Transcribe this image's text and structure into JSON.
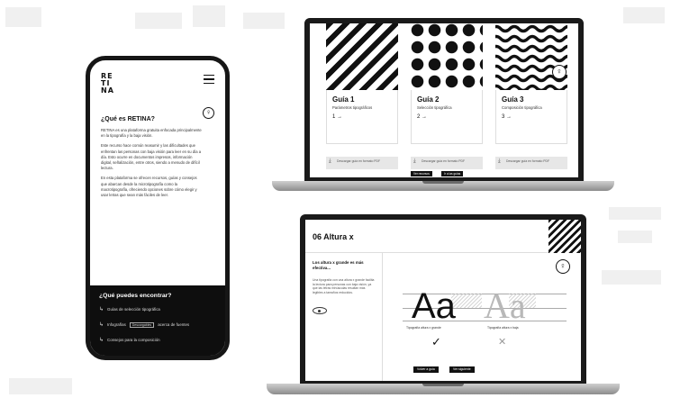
{
  "phone": {
    "logo_lines": [
      "RE",
      "TI",
      "NA"
    ],
    "title": "¿Qué es RETINA?",
    "paragraphs": [
      "RETINA es una plataforma gratuita enfocada principalmente en la tipografía y la baja visión.",
      "Este recurso hace común reasumir y las dificultades que enfrentan las personas con baja visión para leer en su día a día. Esto ocurre en documentos impresos, información digital, señalización, entre otros, siendo a menudo de difícil lectura.",
      "En esta plataforma se ofrecen recursos, guías y consejos que abarcan desde la microtipografía como la macrotipografía, ofreciendo opciones sobre cómo elegir y usar letras que sean más fáciles de leer."
    ],
    "section_title": "¿Qué puedes encontrar?",
    "list": [
      {
        "label": "Guías de selección tipográfica"
      },
      {
        "label": "Infografías",
        "pill": "Descargables",
        "suffix": "acerca de fuentes"
      },
      {
        "label": "Consejos para la composición"
      }
    ]
  },
  "laptop1": {
    "guides": [
      {
        "title": "Guía 1",
        "subtitle": "Parámetros tipográficos",
        "arrow": "1 →",
        "download": "Descargar guía en formato PDF"
      },
      {
        "title": "Guía 2",
        "subtitle": "Selección tipográfica",
        "arrow": "2 →",
        "download": "Descargar guía en formato PDF"
      },
      {
        "title": "Guía 3",
        "subtitle": "Composición tipográfica",
        "arrow": "3 →",
        "download": "Descargar guía en formato PDF"
      }
    ],
    "buttons": [
      "Ver recursos",
      "Ir a las guías"
    ]
  },
  "laptop2": {
    "title": "06 Altura x",
    "sidebar_heading": "Los altura x grande es más efectiva...",
    "sidebar_text": "Una tipografía con una altura x grande facilita la lectura para personas con baja visión, ya que las letras minúsculas resultan más legibles a tamaños reducidos.",
    "sample_text": "Aa",
    "caption_left": "Tipografía altura x grande",
    "caption_right": "Tipografía altura x baja",
    "buttons": [
      "Volver a guía",
      "Ver siguiente"
    ]
  }
}
